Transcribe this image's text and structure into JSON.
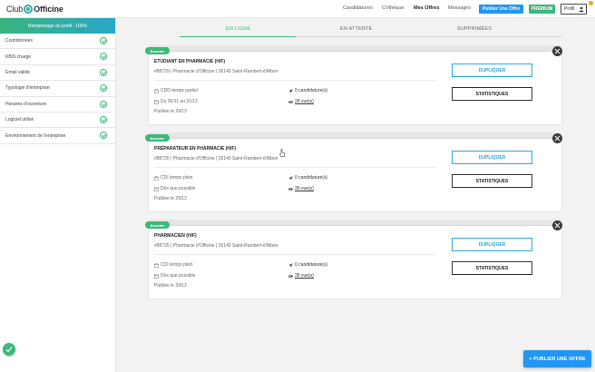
{
  "topnav": {
    "logo_left": "Club",
    "logo_right": "Officine",
    "links": [
      "Candidatures",
      "CVthèque",
      "Mes Offres",
      "Messages"
    ],
    "active_link": "Mes Offres",
    "publish_label": "Publier Une Offre",
    "premium_label": "PREMIUM",
    "profil_label": "Profil"
  },
  "sidebar": {
    "header": "Remplissage du profil : 100%",
    "items": [
      {
        "label": "Coordonnées"
      },
      {
        "label": "KBIS chargé"
      },
      {
        "label": "Email validé"
      },
      {
        "label": "Typologie d'entreprise"
      },
      {
        "label": "Horaires d'ouverture"
      },
      {
        "label": "Logiciel utilisé"
      },
      {
        "label": "Environnement de l'entreprise"
      }
    ]
  },
  "tabs": {
    "online": "EN LIGNE",
    "pending": "EN ATTENTE",
    "deleted": "SUPPRIMÉES"
  },
  "offers": [
    {
      "badge": "Boostée",
      "title": "ETUDIANT EN PHARMACIE (H/F)",
      "ref": "#88729 | Pharmacie d'Officine | 26140 Saint-Rambert-d'Albon",
      "contract": "CDD temps partiel",
      "dates": "Du 30/11 au 31/12",
      "candidatures": "0 candidature(s)",
      "views": "28 vue(s)",
      "published": "Publiée le 29/12",
      "duplicate_label": "DUPLIQUER",
      "stats_label": "STATISTIQUES"
    },
    {
      "badge": "Boostée",
      "title": "PRÉPARATEUR EN PHARMACIE (H/F)",
      "ref": "#88726 | Pharmacie d'Officine | 26140 Saint-Rambert-d'Albon",
      "contract": "CDI temps plein",
      "dates": "Dès que possible",
      "candidatures": "0 candidature(s)",
      "views": "39 vue(s)",
      "published": "Publiée le 29/12",
      "duplicate_label": "DUPLIQUER",
      "stats_label": "STATISTIQUES"
    },
    {
      "badge": "Boostée",
      "title": "PHARMACIEN (H/F)",
      "ref": "#88725 | Pharmacie d'Officine | 26140 Saint-Rambert-d'Albon",
      "contract": "CDI temps plein",
      "dates": "Dès que possible",
      "candidatures": "0 candidature(s)",
      "views": "28 vue(s)",
      "published": "Publiée le 29/12",
      "duplicate_label": "DUPLIQUER",
      "stats_label": "STATISTIQUES"
    }
  ],
  "fab": {
    "publish_label": "+ PUBLIER UNE OFFRE"
  },
  "colors": {
    "green": "#3cb878",
    "blue": "#2196f3",
    "teal": "#2aa7d6"
  }
}
